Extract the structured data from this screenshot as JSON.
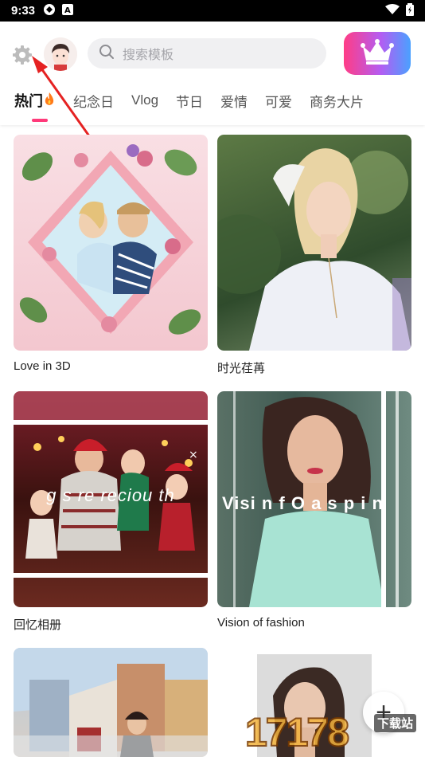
{
  "status_bar": {
    "time": "9:33"
  },
  "header": {
    "search_placeholder": "搜索模板",
    "tabs": [
      {
        "label": "热门"
      },
      {
        "label": "纪念日"
      },
      {
        "label": "Vlog"
      },
      {
        "label": "节日"
      },
      {
        "label": "爱情"
      },
      {
        "label": "可爱"
      },
      {
        "label": "商务大片"
      }
    ]
  },
  "templates": [
    {
      "title": "Love in 3D"
    },
    {
      "title": "时光荏苒"
    },
    {
      "title": "回忆相册"
    },
    {
      "title": "Vision of  fashion"
    }
  ],
  "overlay_text": {
    "card3": "g s   re  reciou   th",
    "card4": "Visi n f O a s p i n"
  },
  "fab": {
    "label": "+"
  },
  "watermark": {
    "text": "17178",
    "badge": "下载站"
  },
  "colors": {
    "accent": "#ff3a7a",
    "crown_gradient": [
      "#ff3d86",
      "#b45cf2",
      "#4aa1ff"
    ]
  }
}
